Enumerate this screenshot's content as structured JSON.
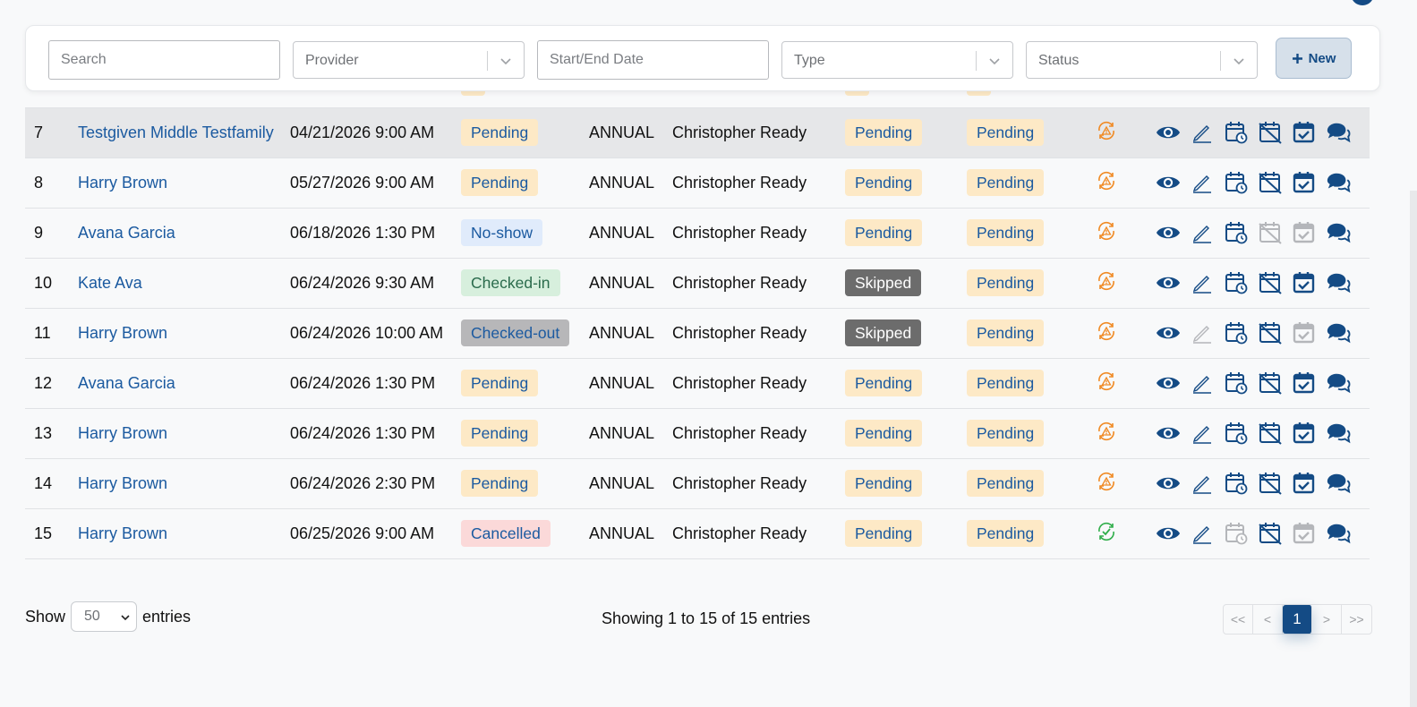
{
  "filters": {
    "search_placeholder": "Search",
    "provider_placeholder": "Provider",
    "date_placeholder": "Start/End Date",
    "type_placeholder": "Type",
    "status_placeholder": "Status",
    "new_label": "New"
  },
  "rows": [
    {
      "num": "7",
      "name": "Testgiven Middle Testfamily",
      "datetime": "04/21/2026 9:00 AM",
      "status": "Pending",
      "type": "ANNUAL",
      "provider": "Christopher Ready",
      "s2": "Pending",
      "s3": "Pending"
    },
    {
      "num": "8",
      "name": "Harry Brown",
      "datetime": "05/27/2026 9:00 AM",
      "status": "Pending",
      "type": "ANNUAL",
      "provider": "Christopher Ready",
      "s2": "Pending",
      "s3": "Pending"
    },
    {
      "num": "9",
      "name": "Avana Garcia",
      "datetime": "06/18/2026 1:30 PM",
      "status": "No-show",
      "type": "ANNUAL",
      "provider": "Christopher Ready",
      "s2": "Pending",
      "s3": "Pending"
    },
    {
      "num": "10",
      "name": "Kate Ava",
      "datetime": "06/24/2026 9:30 AM",
      "status": "Checked-in",
      "type": "ANNUAL",
      "provider": "Christopher Ready",
      "s2": "Skipped",
      "s3": "Pending"
    },
    {
      "num": "11",
      "name": "Harry Brown",
      "datetime": "06/24/2026 10:00 AM",
      "status": "Checked-out",
      "type": "ANNUAL",
      "provider": "Christopher Ready",
      "s2": "Skipped",
      "s3": "Pending"
    },
    {
      "num": "12",
      "name": "Avana Garcia",
      "datetime": "06/24/2026 1:30 PM",
      "status": "Pending",
      "type": "ANNUAL",
      "provider": "Christopher Ready",
      "s2": "Pending",
      "s3": "Pending"
    },
    {
      "num": "13",
      "name": "Harry Brown",
      "datetime": "06/24/2026 1:30 PM",
      "status": "Pending",
      "type": "ANNUAL",
      "provider": "Christopher Ready",
      "s2": "Pending",
      "s3": "Pending"
    },
    {
      "num": "14",
      "name": "Harry Brown",
      "datetime": "06/24/2026 2:30 PM",
      "status": "Pending",
      "type": "ANNUAL",
      "provider": "Christopher Ready",
      "s2": "Pending",
      "s3": "Pending"
    },
    {
      "num": "15",
      "name": "Harry Brown",
      "datetime": "06/25/2026 9:00 AM",
      "status": "Cancelled",
      "type": "ANNUAL",
      "provider": "Christopher Ready",
      "s2": "Pending",
      "s3": "Pending"
    }
  ],
  "footer": {
    "show_label": "Show",
    "entries_value": "50",
    "entries_label": "entries",
    "showing_text": "Showing 1 to 15 of 15 entries",
    "pager": {
      "first": "<<",
      "prev": "<",
      "current": "1",
      "next": ">",
      "last": ">>"
    }
  },
  "colors": {
    "primary": "#144b85",
    "link": "#1b5aa0",
    "pending_bg": "#fde9c6",
    "warning_orange": "#f08a24",
    "success_green": "#2fae4a"
  }
}
